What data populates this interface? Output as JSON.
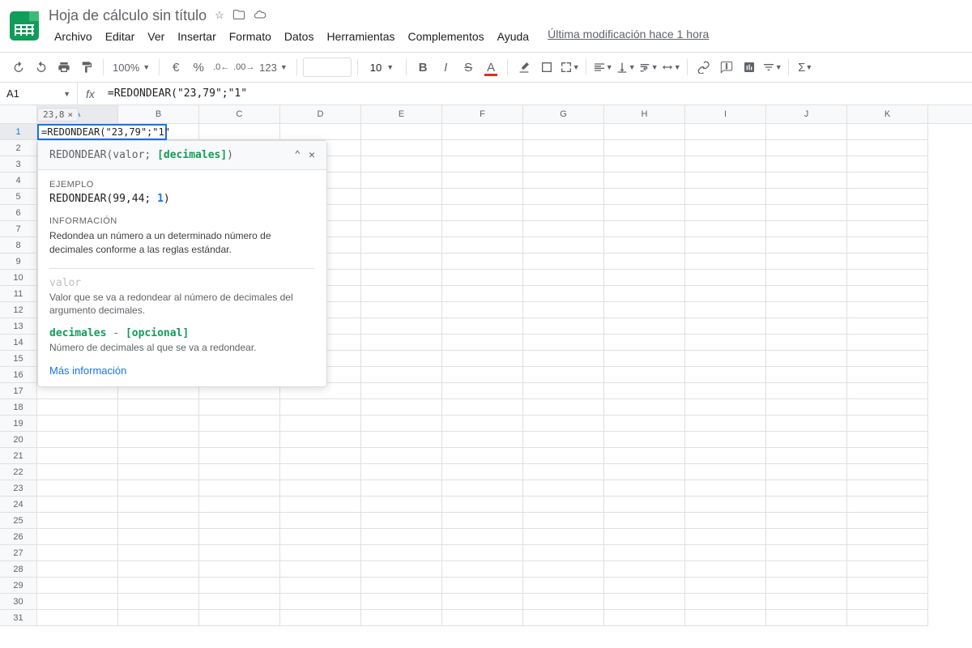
{
  "header": {
    "doc_title": "Hoja de cálculo sin título",
    "last_modification": "Última modificación hace 1 hora"
  },
  "menubar": {
    "items": [
      "Archivo",
      "Editar",
      "Ver",
      "Insertar",
      "Formato",
      "Datos",
      "Herramientas",
      "Complementos",
      "Ayuda"
    ]
  },
  "toolbar": {
    "zoom": "100%",
    "currency": "€",
    "percent": "%",
    "number_format": "123",
    "font_size": "10"
  },
  "formula_bar": {
    "cell_ref": "A1",
    "fx_label": "fx",
    "formula": "=REDONDEAR(\"23,79\";\"1\""
  },
  "columns": [
    "A",
    "B",
    "C",
    "D",
    "E",
    "F",
    "G",
    "H",
    "I",
    "J",
    "K"
  ],
  "rows": [
    1,
    2,
    3,
    4,
    5,
    6,
    7,
    8,
    9,
    10,
    11,
    12,
    13,
    14,
    15,
    16,
    17,
    18,
    19,
    20,
    21,
    22,
    23,
    24,
    25,
    26,
    27,
    28,
    29,
    30,
    31
  ],
  "active_cell": {
    "ref": "A1",
    "content": "=REDONDEAR(\"23,79\";\"1\"",
    "preview": "23,8"
  },
  "tooltip": {
    "signature_fn": "REDONDEAR",
    "signature_arg1": "valor",
    "signature_arg2": "[decimales]",
    "example_label": "EJEMPLO",
    "example_fn": "REDONDEAR(99,44; ",
    "example_num": "1",
    "example_close": ")",
    "info_label": "INFORMACIÓN",
    "info_text": "Redondea un número a un determinado número de decimales conforme a las reglas estándar.",
    "param1_name": "valor",
    "param1_desc": "Valor que se va a redondear al número de decimales del argumento decimales.",
    "param2_name": "decimales",
    "param2_dash": " - ",
    "param2_opt": "[opcional]",
    "param2_desc": "Número de decimales al que se va a redondear.",
    "more_info": "Más información"
  }
}
